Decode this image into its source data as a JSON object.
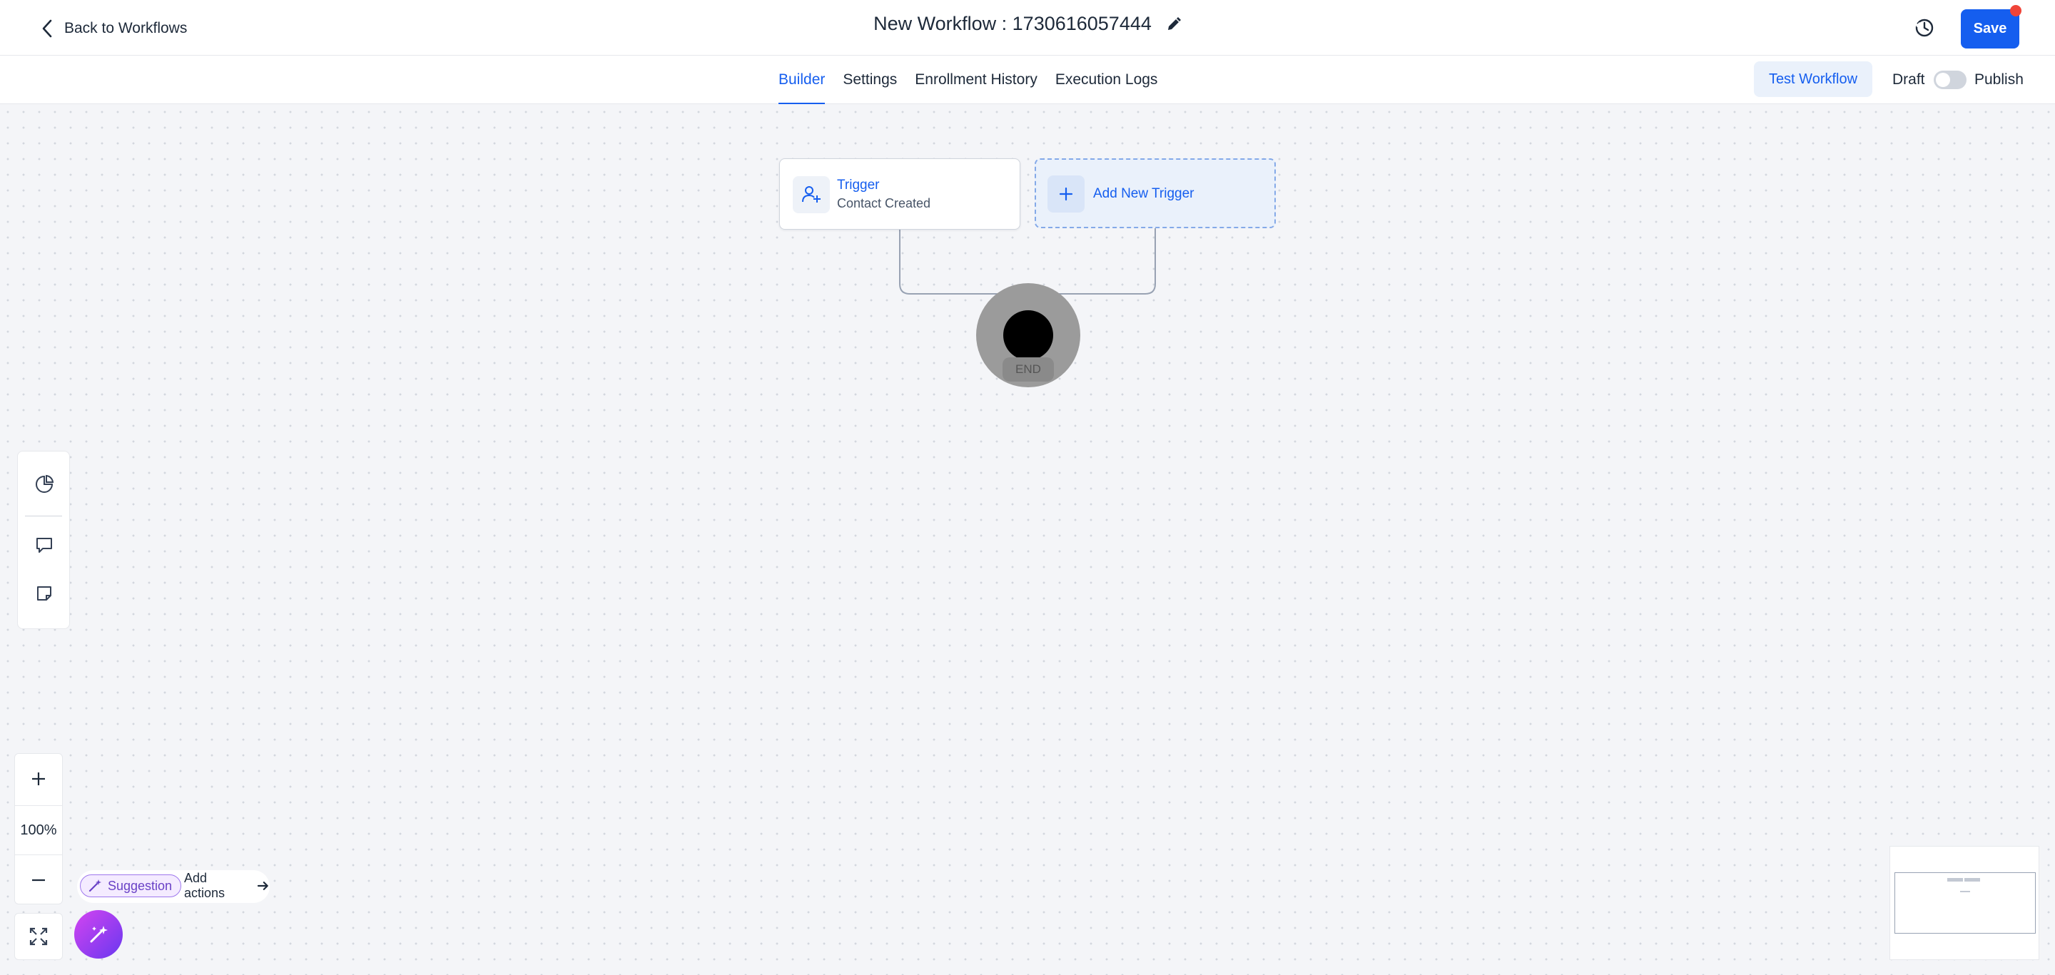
{
  "header": {
    "back_label": "Back to Workflows",
    "title": "New Workflow : 1730616057444",
    "save_label": "Save"
  },
  "tabs": [
    {
      "label": "Builder",
      "active": true
    },
    {
      "label": "Settings",
      "active": false
    },
    {
      "label": "Enrollment History",
      "active": false
    },
    {
      "label": "Execution Logs",
      "active": false
    }
  ],
  "toolbar": {
    "test_label": "Test Workflow",
    "draft_label": "Draft",
    "publish_label": "Publish",
    "published": false
  },
  "canvas": {
    "trigger_node": {
      "title": "Trigger",
      "subtitle": "Contact Created",
      "icon": "user-plus-icon"
    },
    "add_trigger": {
      "label": "Add New Trigger",
      "icon": "plus-icon"
    },
    "end_node": {
      "label": "END"
    }
  },
  "side_tools": [
    {
      "icon": "pie-chart-icon"
    },
    {
      "icon": "comment-icon"
    },
    {
      "icon": "sticky-note-icon"
    }
  ],
  "zoom": {
    "level": "100%"
  },
  "suggestion": {
    "badge": "Suggestion",
    "action": "Add actions"
  },
  "colors": {
    "primary": "#155eef",
    "canvas": "#f4f5f8",
    "ai_gradient_start": "#d444f1",
    "ai_gradient_end": "#6938ef",
    "notification": "#f04438"
  }
}
